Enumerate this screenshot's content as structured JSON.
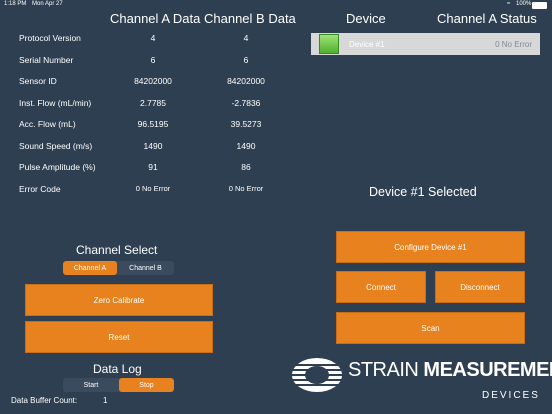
{
  "status_bar": {
    "time": "1:18 PM",
    "date": "Mon Apr 27",
    "battery": "100%"
  },
  "table": {
    "col_a": "Channel A Data",
    "col_b": "Channel B Data",
    "rows": [
      {
        "label": "Protocol Version",
        "a": "4",
        "b": "4"
      },
      {
        "label": "Serial Number",
        "a": "6",
        "b": "6"
      },
      {
        "label": "Sensor ID",
        "a": "84202000",
        "b": "84202000"
      },
      {
        "label": "Inst. Flow (mL/min)",
        "a": "2.7785",
        "b": "-2.7836"
      },
      {
        "label": "Acc. Flow (mL)",
        "a": "96.5195",
        "b": "39.5273"
      },
      {
        "label": "Sound Speed (m/s)",
        "a": "1490",
        "b": "1490"
      },
      {
        "label": "Pulse Amplitude (%)",
        "a": "91",
        "b": "86"
      },
      {
        "label": "Error Code",
        "a": "0 No Error",
        "b": "0 No Error"
      }
    ]
  },
  "devices": {
    "header_device": "Device",
    "header_status": "Channel A Status",
    "list": [
      {
        "name": "Device #1",
        "status": "0 No Error"
      }
    ],
    "selected_text": "Device #1 Selected"
  },
  "channel_select": {
    "title": "Channel Select",
    "options": [
      "Channel A",
      "Channel B"
    ],
    "selected": "Channel A"
  },
  "buttons": {
    "zero_calibrate": "Zero Calibrate",
    "reset": "Reset",
    "configure": "Configure Device #1",
    "connect": "Connect",
    "disconnect": "Disconnect",
    "scan": "Scan"
  },
  "data_log": {
    "title": "Data Log",
    "start": "Start",
    "stop": "Stop",
    "buffer_label": "Data Buffer Count:",
    "buffer_count": "1"
  },
  "logo": {
    "line1a": "STRAIN",
    "line1b": "MEASUREMENT",
    "line2": "DEVICES"
  },
  "colors": {
    "background": "#2e3f51",
    "accent": "#e8821e"
  }
}
